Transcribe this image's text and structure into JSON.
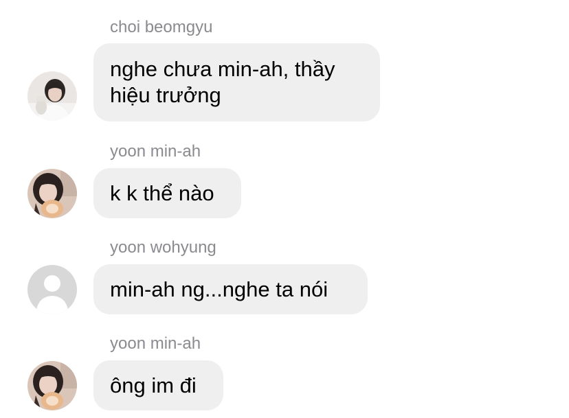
{
  "thread": {
    "messages": [
      {
        "sender": "choi beomgyu",
        "text": "nghe chưa min-ah, thầy hiệu trưởng",
        "avatar_icon": "photo-avatar-beomgyu"
      },
      {
        "sender": "yoon min-ah",
        "text": "k k thể nào",
        "avatar_icon": "photo-avatar-minah"
      },
      {
        "sender": "yoon wohyung",
        "text": "min-ah ng...nghe ta nói",
        "avatar_icon": "default-user-avatar-icon"
      },
      {
        "sender": "yoon min-ah",
        "text": "ông im đi",
        "avatar_icon": "photo-avatar-minah"
      }
    ]
  },
  "colors": {
    "bubble_bg": "#efefef",
    "sender_text": "#8a8a8f",
    "message_text": "#000000",
    "default_avatar_bg": "#d8d8d8",
    "default_avatar_fg": "#ffffff"
  }
}
